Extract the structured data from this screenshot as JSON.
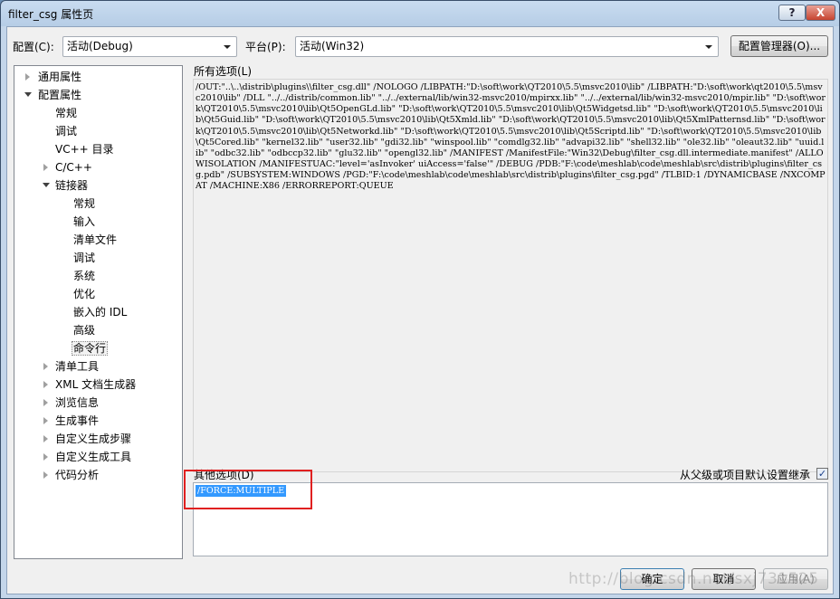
{
  "window": {
    "title": "filter_csg 属性页",
    "help_label": "?",
    "close_label": "X"
  },
  "toolbar": {
    "config_label": "配置(C):",
    "config_value": "活动(Debug)",
    "platform_label": "平台(P):",
    "platform_value": "活动(Win32)",
    "config_manager_label": "配置管理器(O)..."
  },
  "tree": {
    "items": [
      {
        "label": "通用属性"
      },
      {
        "label": "配置属性"
      },
      {
        "label": "常规"
      },
      {
        "label": "调试"
      },
      {
        "label": "VC++ 目录"
      },
      {
        "label": "C/C++"
      },
      {
        "label": "链接器"
      },
      {
        "label": "常规"
      },
      {
        "label": "输入"
      },
      {
        "label": "清单文件"
      },
      {
        "label": "调试"
      },
      {
        "label": "系统"
      },
      {
        "label": "优化"
      },
      {
        "label": "嵌入的 IDL"
      },
      {
        "label": "高级"
      },
      {
        "label": "命令行"
      },
      {
        "label": "清单工具"
      },
      {
        "label": "XML 文档生成器"
      },
      {
        "label": "浏览信息"
      },
      {
        "label": "生成事件"
      },
      {
        "label": "自定义生成步骤"
      },
      {
        "label": "自定义生成工具"
      },
      {
        "label": "代码分析"
      }
    ]
  },
  "main": {
    "all_options_label": "所有选项(L)",
    "all_options_text": "/OUT:\"..\\..\\distrib\\plugins\\\\filter_csg.dll\" /NOLOGO /LIBPATH:\"D:\\soft\\work\\QT2010\\5.5\\msvc2010\\lib\" /LIBPATH:\"D:\\soft\\work\\qt2010\\5.5\\msvc2010\\lib\" /DLL \"../../distrib/common.lib\" \"../../external/lib/win32-msvc2010/mpirxx.lib\" \"../../external/lib/win32-msvc2010/mpir.lib\" \"D:\\soft\\work\\QT2010\\5.5\\msvc2010\\lib\\Qt5OpenGLd.lib\" \"D:\\soft\\work\\QT2010\\5.5\\msvc2010\\lib\\Qt5Widgetsd.lib\" \"D:\\soft\\work\\QT2010\\5.5\\msvc2010\\lib\\Qt5Guid.lib\" \"D:\\soft\\work\\QT2010\\5.5\\msvc2010\\lib\\Qt5Xmld.lib\" \"D:\\soft\\work\\QT2010\\5.5\\msvc2010\\lib\\Qt5XmlPatternsd.lib\" \"D:\\soft\\work\\QT2010\\5.5\\msvc2010\\lib\\Qt5Networkd.lib\" \"D:\\soft\\work\\QT2010\\5.5\\msvc2010\\lib\\Qt5Scriptd.lib\" \"D:\\soft\\work\\QT2010\\5.5\\msvc2010\\lib\\Qt5Cored.lib\" \"kernel32.lib\" \"user32.lib\" \"gdi32.lib\" \"winspool.lib\" \"comdlg32.lib\" \"advapi32.lib\" \"shell32.lib\" \"ole32.lib\" \"oleaut32.lib\" \"uuid.lib\" \"odbc32.lib\" \"odbccp32.lib\" \"glu32.lib\" \"opengl32.lib\" /MANIFEST /ManifestFile:\"Win32\\Debug\\filter_csg.dll.intermediate.manifest\" /ALLOWISOLATION /MANIFESTUAC:\"level='asInvoker' uiAccess='false'\" /DEBUG /PDB:\"F:\\code\\meshlab\\code\\meshlab\\src\\distrib\\plugins\\filter_csg.pdb\" /SUBSYSTEM:WINDOWS /PGD:\"F:\\code\\meshlab\\code\\meshlab\\src\\distrib\\plugins\\filter_csg.pgd\" /TLBID:1 /DYNAMICBASE /NXCOMPAT /MACHINE:X86 /ERRORREPORT:QUEUE",
    "other_options_label": "其他选项(D)",
    "other_options_value": "/FORCE:MULTIPLE",
    "inherit_label": "从父级或项目默认设置继承",
    "inherit_checked": "✓"
  },
  "footer": {
    "ok_label": "确定",
    "cancel_label": "取消",
    "apply_label": "应用(A)"
  },
  "watermark": "http://blog.csdn.net/sxj731525",
  "colors": {
    "selection": "#3399ff",
    "highlight_border": "#e02020"
  }
}
